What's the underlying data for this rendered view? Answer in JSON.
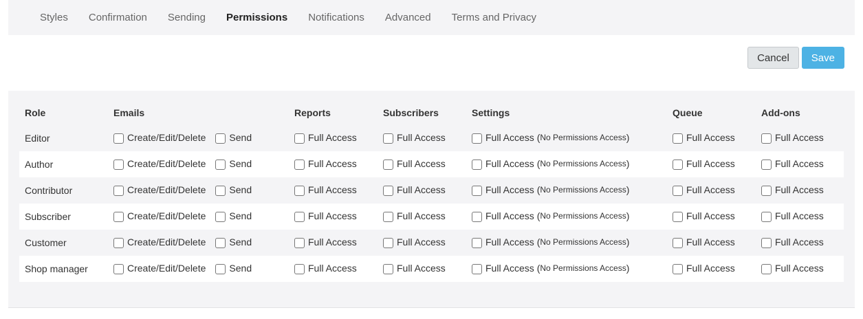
{
  "tabs": [
    {
      "label": "Styles",
      "active": false
    },
    {
      "label": "Confirmation",
      "active": false
    },
    {
      "label": "Sending",
      "active": false
    },
    {
      "label": "Permissions",
      "active": true
    },
    {
      "label": "Notifications",
      "active": false
    },
    {
      "label": "Advanced",
      "active": false
    },
    {
      "label": "Terms and Privacy",
      "active": false
    }
  ],
  "actions": {
    "cancel_label": "Cancel",
    "save_label": "Save"
  },
  "table": {
    "headers": {
      "role": "Role",
      "emails": "Emails",
      "reports": "Reports",
      "subscribers": "Subscribers",
      "settings": "Settings",
      "queue": "Queue",
      "addons": "Add-ons"
    },
    "labels": {
      "create_edit_delete": "Create/Edit/Delete",
      "send": "Send",
      "full_access": "Full Access",
      "settings_full_access": "Full Access (",
      "settings_note": "No Permissions Access",
      "settings_close": ")"
    },
    "rows": [
      {
        "role": "Editor"
      },
      {
        "role": "Author"
      },
      {
        "role": "Contributor"
      },
      {
        "role": "Subscriber"
      },
      {
        "role": "Customer"
      },
      {
        "role": "Shop manager"
      }
    ]
  }
}
